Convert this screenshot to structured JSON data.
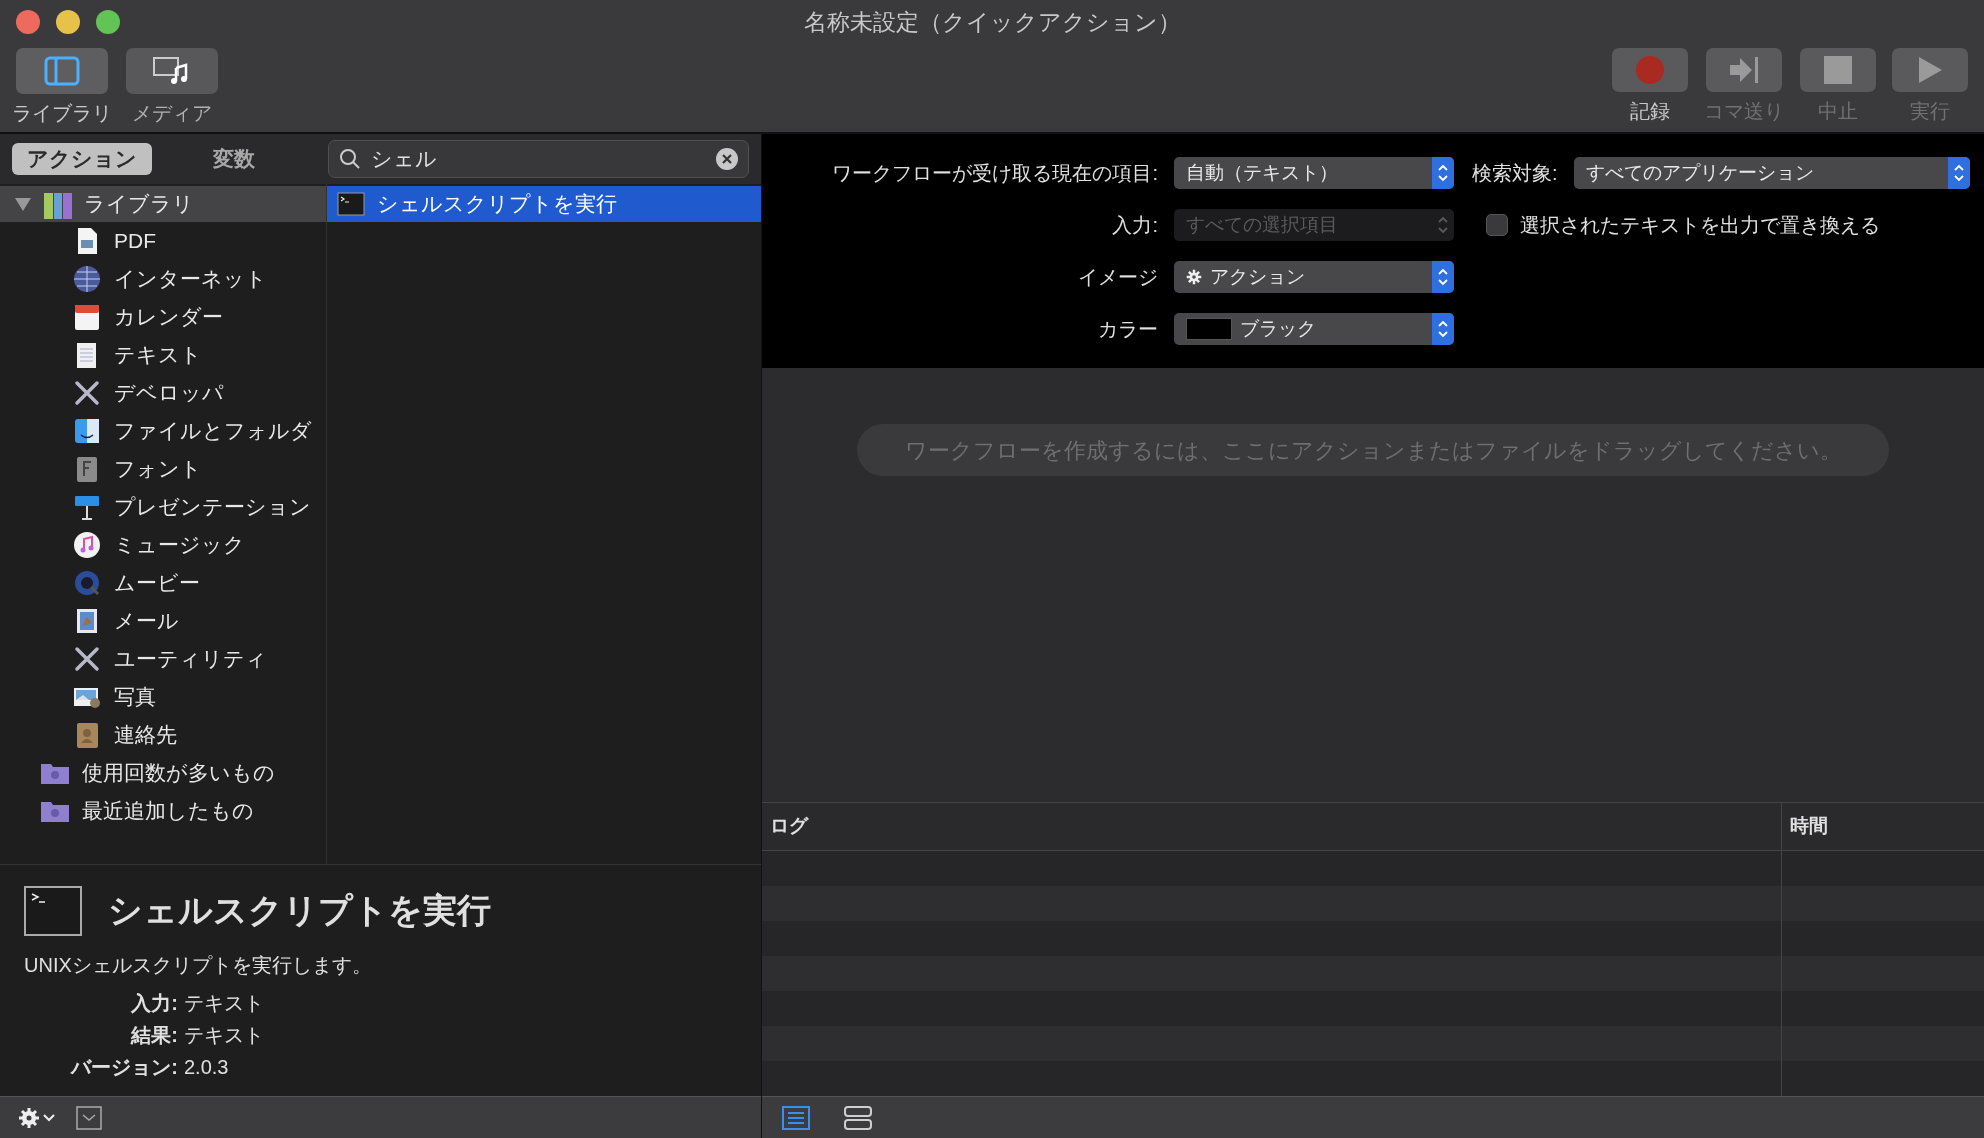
{
  "window": {
    "title": "名称未設定（クイックアクション）"
  },
  "toolbar_left": [
    {
      "label": "ライブラリ",
      "kind": "library",
      "selected": true
    },
    {
      "label": "メディア",
      "kind": "media",
      "selected": false
    }
  ],
  "toolbar_right": [
    {
      "label": "記録",
      "kind": "record",
      "disabled": false
    },
    {
      "label": "コマ送り",
      "kind": "step",
      "disabled": true
    },
    {
      "label": "中止",
      "kind": "stop",
      "disabled": true
    },
    {
      "label": "実行",
      "kind": "run",
      "disabled": true
    }
  ],
  "tabs": [
    {
      "label": "アクション",
      "selected": true
    },
    {
      "label": "変数",
      "selected": false
    }
  ],
  "search": {
    "value": "シェル"
  },
  "library": {
    "label": "ライブラリ",
    "expanded": true,
    "children": [
      {
        "label": "PDF",
        "kind": "pdf"
      },
      {
        "label": "インターネット",
        "kind": "globe"
      },
      {
        "label": "カレンダー",
        "kind": "calendar"
      },
      {
        "label": "テキスト",
        "kind": "text"
      },
      {
        "label": "デベロッパ",
        "kind": "tools"
      },
      {
        "label": "ファイルとフォルダ",
        "kind": "finder"
      },
      {
        "label": "フォント",
        "kind": "font"
      },
      {
        "label": "プレゼンテーション",
        "kind": "presentation"
      },
      {
        "label": "ミュージック",
        "kind": "music"
      },
      {
        "label": "ムービー",
        "kind": "movie"
      },
      {
        "label": "メール",
        "kind": "mail"
      },
      {
        "label": "ユーティリティ",
        "kind": "tools"
      },
      {
        "label": "写真",
        "kind": "photos"
      },
      {
        "label": "連絡先",
        "kind": "contacts"
      }
    ]
  },
  "smart_folders": [
    {
      "label": "使用回数が多いもの"
    },
    {
      "label": "最近追加したもの"
    }
  ],
  "results": [
    {
      "label": "シェルスクリプトを実行",
      "selected": true
    }
  ],
  "info": {
    "title": "シェルスクリプトを実行",
    "description": "UNIXシェルスクリプトを実行します。",
    "fields": [
      {
        "label": "入力:",
        "value": "テキスト"
      },
      {
        "label": "結果:",
        "value": "テキスト"
      },
      {
        "label": "バージョン:",
        "value": "2.0.3"
      }
    ]
  },
  "settings": {
    "receives": {
      "label": "ワークフローが受け取る現在の項目:",
      "value": "自動（テキスト）"
    },
    "search_target": {
      "label": "検索対象:",
      "value": "すべてのアプリケーション"
    },
    "input": {
      "label": "入力:",
      "value": "すべての選択項目",
      "disabled": true
    },
    "replace": {
      "label": "選択されたテキストを出力で置き換える",
      "checked": false
    },
    "image": {
      "label": "イメージ",
      "value": "アクション"
    },
    "color": {
      "label": "カラー",
      "value": "ブラック"
    }
  },
  "drop_hint": "ワークフローを作成するには、ここにアクションまたはファイルをドラッグしてください。",
  "log": {
    "columns": [
      "ログ",
      "時間"
    ]
  },
  "view_buttons": [
    {
      "kind": "list",
      "selected": true
    },
    {
      "kind": "split",
      "selected": false
    }
  ]
}
